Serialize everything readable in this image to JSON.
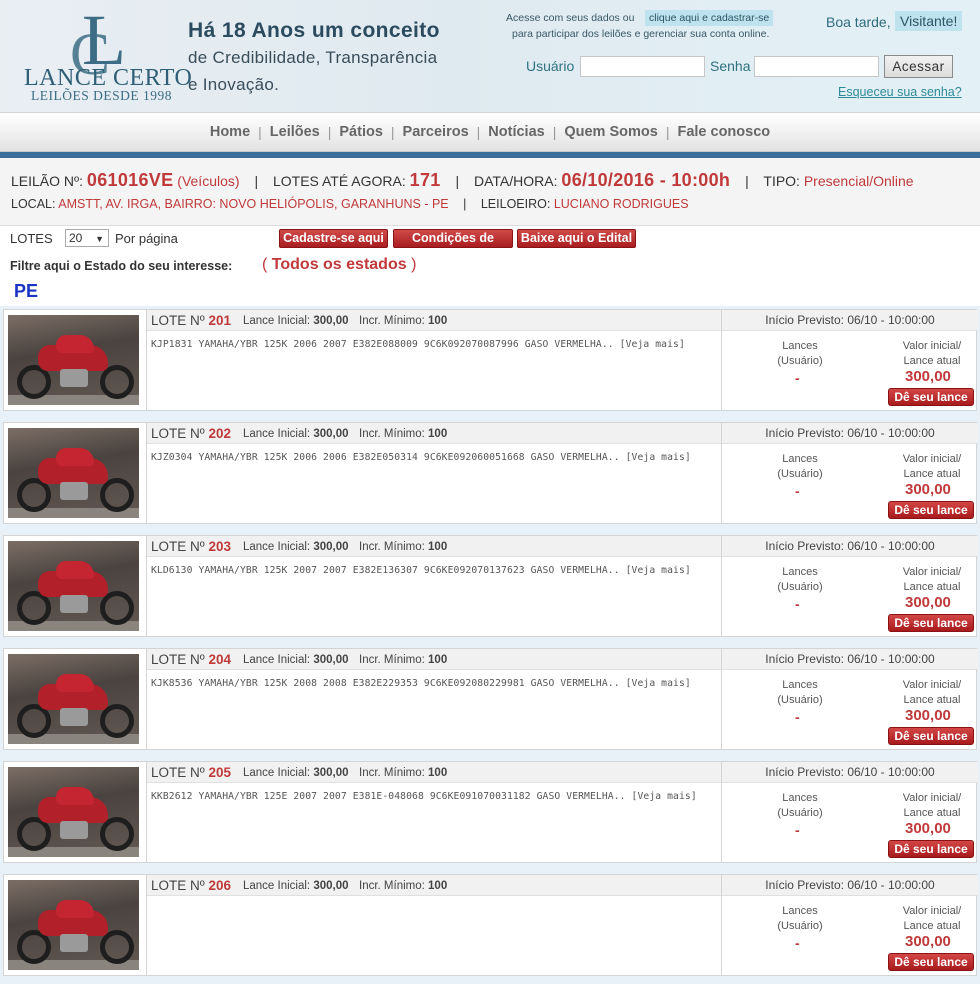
{
  "header": {
    "logo_letters": "LC",
    "logo_name": "LANCE CERTO",
    "logo_tagline": "LEILÕES DESDE 1998",
    "slogan_line1": "Há 18 Anos um conceito",
    "slogan_line2": "de Credibilidade, Transparência",
    "slogan_line3": "e Inovação.",
    "login_hint_prefix": "Acesse com seus dados ou",
    "register_link": "clique aqui e cadastrar-se",
    "login_hint_suffix": "para participar dos leilões e gerenciar sua conta online.",
    "greeting": "Boa tarde,",
    "visitor": "Visitante!",
    "user_label": "Usuário",
    "user_value": "",
    "pass_label": "Senha",
    "pass_value": "",
    "login_button": "Acessar",
    "forgot_link": "Esqueceu sua senha?"
  },
  "nav": {
    "items": [
      "Home",
      "Leilões",
      "Pátios",
      "Parceiros",
      "Notícias",
      "Quem Somos",
      "Fale conosco"
    ]
  },
  "auction": {
    "leilao_label": "LEILÃO Nº:",
    "leilao_number": "061016VE",
    "leilao_category": "(Veículos)",
    "lotes_label": "LOTES ATÉ AGORA:",
    "lotes_count": "171",
    "datetime_label": "DATA/HORA:",
    "datetime": "06/10/2016 - 10:00h",
    "tipo_label": "TIPO:",
    "tipo": "Presencial/Online",
    "local_label": "LOCAL:",
    "local": "AMSTT, AV. IRGA, BAIRRO: NOVO HELIÓPOLIS, GARANHUNS - PE",
    "leiloeiro_label": "LEILOEIRO:",
    "leiloeiro": "LUCIANO RODRIGUES"
  },
  "controls": {
    "lotes_label": "LOTES",
    "per_page_value": "20",
    "per_page_suffix": "Por página",
    "btn_register": "Cadastre-se aqui",
    "btn_conditions": "Condições de Venda",
    "btn_edital": "Baixe aqui o Edital",
    "filter_label": "Filtre aqui o Estado do seu interesse:",
    "filter_open": "(",
    "filter_value": "Todos os estados",
    "filter_close": ")",
    "state": "PE"
  },
  "lot_labels": {
    "lote": "LOTE Nº",
    "lance_inicial": "Lance Inicial:",
    "incr_minimo": "Incr. Mínimo:",
    "lances_l1": "Lances",
    "lances_l2": "(Usuário)",
    "valor_l1": "Valor inicial/",
    "valor_l2": "Lance atual",
    "bid_button": "Dê seu lance"
  },
  "lots": [
    {
      "number": "201",
      "lance": "300,00",
      "incr": "100",
      "desc": "KJP1831 YAMAHA/YBR 125K 2006 2007 E382E088009 9C6K092070087996 GASO VERMELHA.. [Veja mais]",
      "inicio": "Início Previsto: 06/10 - 10:00:00",
      "lances": "-",
      "valor": "300,00"
    },
    {
      "number": "202",
      "lance": "300,00",
      "incr": "100",
      "desc": "KJZ0304 YAMAHA/YBR 125K 2006 2006 E382E050314 9C6KE092060051668 GASO VERMELHA.. [Veja mais]",
      "inicio": "Início Previsto: 06/10 - 10:00:00",
      "lances": "-",
      "valor": "300,00"
    },
    {
      "number": "203",
      "lance": "300,00",
      "incr": "100",
      "desc": "KLD6130 YAMAHA/YBR 125K 2007 2007 E382E136307 9C6KE092070137623 GASO VERMELHA.. [Veja mais]",
      "inicio": "Início Previsto: 06/10 - 10:00:00",
      "lances": "-",
      "valor": "300,00"
    },
    {
      "number": "204",
      "lance": "300,00",
      "incr": "100",
      "desc": "KJK8536 YAMAHA/YBR 125K 2008 2008 E382E229353 9C6KE092080229981 GASO VERMELHA.. [Veja mais]",
      "inicio": "Início Previsto: 06/10 - 10:00:00",
      "lances": "-",
      "valor": "300,00"
    },
    {
      "number": "205",
      "lance": "300,00",
      "incr": "100",
      "desc": "KKB2612 YAMAHA/YBR 125E 2007 2007 E381E-048068 9C6KE091070031182 GASO VERMELHA.. [Veja mais]",
      "inicio": "Início Previsto: 06/10 - 10:00:00",
      "lances": "-",
      "valor": "300,00"
    },
    {
      "number": "206",
      "lance": "300,00",
      "incr": "100",
      "desc": "",
      "inicio": "Início Previsto: 06/10 - 10:00:00",
      "lances": "-",
      "valor": "300,00"
    }
  ]
}
